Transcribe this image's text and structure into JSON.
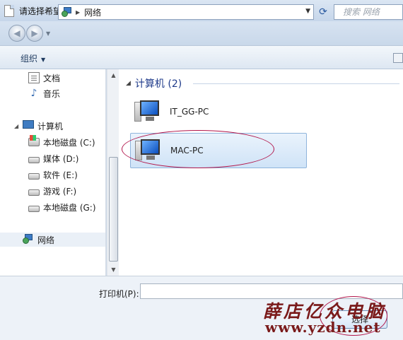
{
  "window": {
    "title": "请选择希望使用的网络打印机并单击“选择”以与之连接"
  },
  "address_bar": {
    "breadcrumb": "网络",
    "search_placeholder": "搜索 网络"
  },
  "toolbar": {
    "organize_label": "组织"
  },
  "nav_pane": {
    "items": [
      {
        "label": "文档",
        "icon": "document-icon"
      },
      {
        "label": "音乐",
        "icon": "music-icon"
      },
      {
        "label": "计算机",
        "icon": "computer-icon"
      },
      {
        "label": "本地磁盘 (C:)",
        "icon": "windows-drive-icon"
      },
      {
        "label": "媒体 (D:)",
        "icon": "drive-icon"
      },
      {
        "label": "软件 (E:)",
        "icon": "drive-icon"
      },
      {
        "label": "游戏 (F:)",
        "icon": "drive-icon"
      },
      {
        "label": "本地磁盘 (G:)",
        "icon": "drive-icon"
      },
      {
        "label": "网络",
        "icon": "network-icon",
        "selected": true
      }
    ]
  },
  "content": {
    "group_header": "计算机 (2)",
    "computers": [
      {
        "name": "IT_GG-PC",
        "selected": false
      },
      {
        "name": "MAC-PC",
        "selected": true
      }
    ]
  },
  "bottom": {
    "printer_label": "打印机(P):",
    "printer_value": "",
    "select_button": "选择"
  },
  "watermark": {
    "line1": "薛店亿众电脑",
    "line2": "www.yzdn.net"
  },
  "colors": {
    "accent": "#1e3a8a",
    "annotation": "#b2154a",
    "watermark": "#7a1a1a"
  }
}
